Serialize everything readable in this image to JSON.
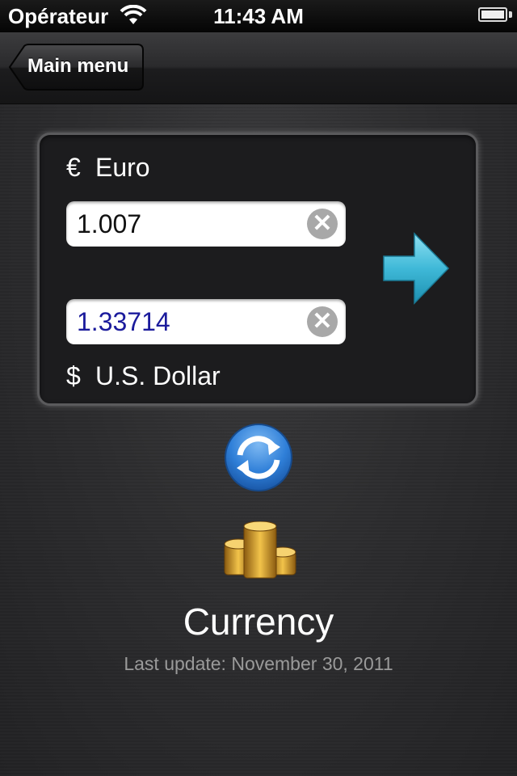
{
  "status_bar": {
    "carrier": "Opérateur",
    "time": "11:43 AM",
    "wifi_icon": "wifi-icon",
    "battery_icon": "battery-icon"
  },
  "nav": {
    "back_label": "Main menu"
  },
  "converter": {
    "from": {
      "symbol": "€",
      "name": "Euro",
      "value": "1.007"
    },
    "to": {
      "symbol": "$",
      "name": "U.S. Dollar",
      "value": "1.33714"
    },
    "clear_glyph": "✕",
    "convert_icon": "arrow-right-icon",
    "swap_icon": "refresh-icon"
  },
  "app": {
    "title": "Currency",
    "last_update": "Last update: November 30, 2011",
    "icon": "coins-icon"
  },
  "colors": {
    "accent_arrow": "#3fb9d8",
    "swap_blue": "#2f7fd8",
    "to_value_text": "#1b1b9c"
  }
}
